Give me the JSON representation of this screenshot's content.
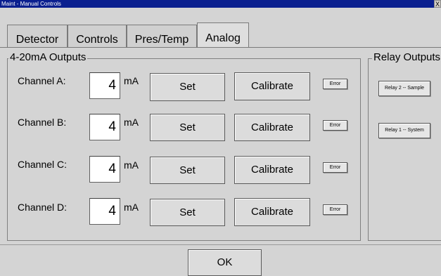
{
  "window": {
    "title": "Maint - Manual Controls",
    "close_label": "X"
  },
  "tabs": [
    {
      "label": "Detector"
    },
    {
      "label": "Controls"
    },
    {
      "label": "Pres/Temp"
    },
    {
      "label": "Analog"
    }
  ],
  "active_tab": "Analog",
  "outputs": {
    "group_label": "4-20mA Outputs",
    "channels": [
      {
        "label": "Channel  A:",
        "value": "4",
        "unit": "mA",
        "set_label": "Set",
        "calibrate_label": "Calibrate",
        "error_label": "Error"
      },
      {
        "label": "Channel  B:",
        "value": "4",
        "unit": "mA",
        "set_label": "Set",
        "calibrate_label": "Calibrate",
        "error_label": "Error"
      },
      {
        "label": "Channel  C:",
        "value": "4",
        "unit": "mA",
        "set_label": "Set",
        "calibrate_label": "Calibrate",
        "error_label": "Error"
      },
      {
        "label": "Channel  D:",
        "value": "4",
        "unit": "mA",
        "set_label": "Set",
        "calibrate_label": "Calibrate",
        "error_label": "Error"
      }
    ]
  },
  "relay": {
    "group_label": "Relay Outputs",
    "buttons": [
      {
        "label": "Relay 2 -- Sample"
      },
      {
        "label": "Relay 1 -- System"
      }
    ]
  },
  "footer": {
    "ok_label": "OK"
  }
}
